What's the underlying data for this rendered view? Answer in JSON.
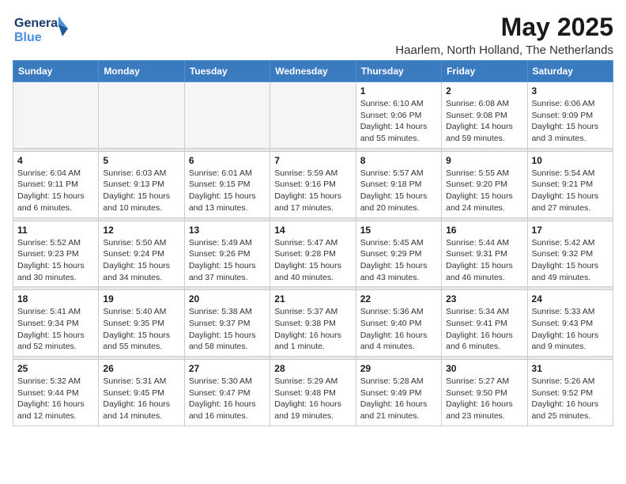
{
  "logo": {
    "line1": "General",
    "line2": "Blue"
  },
  "title": "May 2025",
  "subtitle": "Haarlem, North Holland, The Netherlands",
  "days_of_week": [
    "Sunday",
    "Monday",
    "Tuesday",
    "Wednesday",
    "Thursday",
    "Friday",
    "Saturday"
  ],
  "weeks": [
    [
      {
        "day": "",
        "info": ""
      },
      {
        "day": "",
        "info": ""
      },
      {
        "day": "",
        "info": ""
      },
      {
        "day": "",
        "info": ""
      },
      {
        "day": "1",
        "info": "Sunrise: 6:10 AM\nSunset: 9:06 PM\nDaylight: 14 hours\nand 55 minutes."
      },
      {
        "day": "2",
        "info": "Sunrise: 6:08 AM\nSunset: 9:08 PM\nDaylight: 14 hours\nand 59 minutes."
      },
      {
        "day": "3",
        "info": "Sunrise: 6:06 AM\nSunset: 9:09 PM\nDaylight: 15 hours\nand 3 minutes."
      }
    ],
    [
      {
        "day": "4",
        "info": "Sunrise: 6:04 AM\nSunset: 9:11 PM\nDaylight: 15 hours\nand 6 minutes."
      },
      {
        "day": "5",
        "info": "Sunrise: 6:03 AM\nSunset: 9:13 PM\nDaylight: 15 hours\nand 10 minutes."
      },
      {
        "day": "6",
        "info": "Sunrise: 6:01 AM\nSunset: 9:15 PM\nDaylight: 15 hours\nand 13 minutes."
      },
      {
        "day": "7",
        "info": "Sunrise: 5:59 AM\nSunset: 9:16 PM\nDaylight: 15 hours\nand 17 minutes."
      },
      {
        "day": "8",
        "info": "Sunrise: 5:57 AM\nSunset: 9:18 PM\nDaylight: 15 hours\nand 20 minutes."
      },
      {
        "day": "9",
        "info": "Sunrise: 5:55 AM\nSunset: 9:20 PM\nDaylight: 15 hours\nand 24 minutes."
      },
      {
        "day": "10",
        "info": "Sunrise: 5:54 AM\nSunset: 9:21 PM\nDaylight: 15 hours\nand 27 minutes."
      }
    ],
    [
      {
        "day": "11",
        "info": "Sunrise: 5:52 AM\nSunset: 9:23 PM\nDaylight: 15 hours\nand 30 minutes."
      },
      {
        "day": "12",
        "info": "Sunrise: 5:50 AM\nSunset: 9:24 PM\nDaylight: 15 hours\nand 34 minutes."
      },
      {
        "day": "13",
        "info": "Sunrise: 5:49 AM\nSunset: 9:26 PM\nDaylight: 15 hours\nand 37 minutes."
      },
      {
        "day": "14",
        "info": "Sunrise: 5:47 AM\nSunset: 9:28 PM\nDaylight: 15 hours\nand 40 minutes."
      },
      {
        "day": "15",
        "info": "Sunrise: 5:45 AM\nSunset: 9:29 PM\nDaylight: 15 hours\nand 43 minutes."
      },
      {
        "day": "16",
        "info": "Sunrise: 5:44 AM\nSunset: 9:31 PM\nDaylight: 15 hours\nand 46 minutes."
      },
      {
        "day": "17",
        "info": "Sunrise: 5:42 AM\nSunset: 9:32 PM\nDaylight: 15 hours\nand 49 minutes."
      }
    ],
    [
      {
        "day": "18",
        "info": "Sunrise: 5:41 AM\nSunset: 9:34 PM\nDaylight: 15 hours\nand 52 minutes."
      },
      {
        "day": "19",
        "info": "Sunrise: 5:40 AM\nSunset: 9:35 PM\nDaylight: 15 hours\nand 55 minutes."
      },
      {
        "day": "20",
        "info": "Sunrise: 5:38 AM\nSunset: 9:37 PM\nDaylight: 15 hours\nand 58 minutes."
      },
      {
        "day": "21",
        "info": "Sunrise: 5:37 AM\nSunset: 9:38 PM\nDaylight: 16 hours\nand 1 minute."
      },
      {
        "day": "22",
        "info": "Sunrise: 5:36 AM\nSunset: 9:40 PM\nDaylight: 16 hours\nand 4 minutes."
      },
      {
        "day": "23",
        "info": "Sunrise: 5:34 AM\nSunset: 9:41 PM\nDaylight: 16 hours\nand 6 minutes."
      },
      {
        "day": "24",
        "info": "Sunrise: 5:33 AM\nSunset: 9:43 PM\nDaylight: 16 hours\nand 9 minutes."
      }
    ],
    [
      {
        "day": "25",
        "info": "Sunrise: 5:32 AM\nSunset: 9:44 PM\nDaylight: 16 hours\nand 12 minutes."
      },
      {
        "day": "26",
        "info": "Sunrise: 5:31 AM\nSunset: 9:45 PM\nDaylight: 16 hours\nand 14 minutes."
      },
      {
        "day": "27",
        "info": "Sunrise: 5:30 AM\nSunset: 9:47 PM\nDaylight: 16 hours\nand 16 minutes."
      },
      {
        "day": "28",
        "info": "Sunrise: 5:29 AM\nSunset: 9:48 PM\nDaylight: 16 hours\nand 19 minutes."
      },
      {
        "day": "29",
        "info": "Sunrise: 5:28 AM\nSunset: 9:49 PM\nDaylight: 16 hours\nand 21 minutes."
      },
      {
        "day": "30",
        "info": "Sunrise: 5:27 AM\nSunset: 9:50 PM\nDaylight: 16 hours\nand 23 minutes."
      },
      {
        "day": "31",
        "info": "Sunrise: 5:26 AM\nSunset: 9:52 PM\nDaylight: 16 hours\nand 25 minutes."
      }
    ]
  ]
}
